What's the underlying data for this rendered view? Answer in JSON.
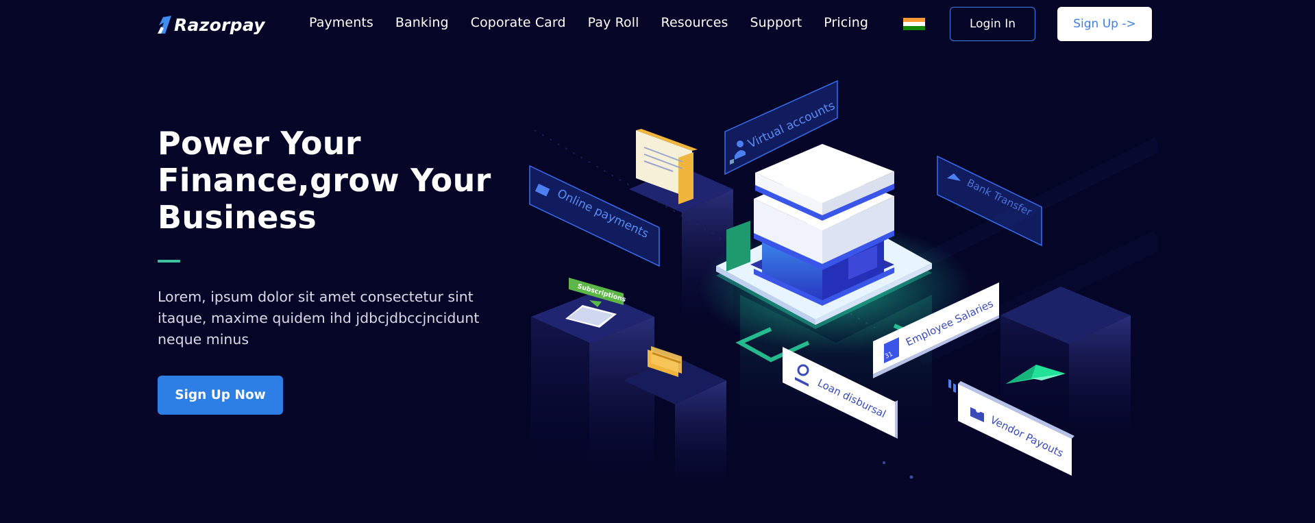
{
  "brand": {
    "name": "Razorpay"
  },
  "nav": {
    "links": [
      "Payments",
      "Banking",
      "Coporate Card",
      "Pay Roll",
      "Resources",
      "Support",
      "Pricing"
    ],
    "flag_colors": [
      "#ff9933",
      "#ffffff",
      "#138808"
    ],
    "login_label": "Login In",
    "signup_label": "Sign Up ->"
  },
  "hero": {
    "title": "Power Your Finance,grow Your Business",
    "description": "Lorem, ipsum dolor sit amet consectetur sint itaque, maxime quidem ihd jdbcjdbccjncidunt neque minus",
    "cta_label": "Sign Up Now"
  },
  "illustration": {
    "tags": {
      "virtual_accounts": "Virtual accounts",
      "online_payments": "Online payments",
      "bank_transfer": "Bank Transfer",
      "subscriptions": "Subscriptions",
      "employee_salaries": "Employee Salaries",
      "loan_disbursal": "Loan disbursal",
      "vendor_payouts": "Vendor Payouts",
      "calendar_day": "31"
    }
  },
  "colors": {
    "background": "#050528",
    "accent_blue": "#2d7fe6",
    "accent_green": "#3fbf9f",
    "glow_green": "#22f0b0"
  }
}
